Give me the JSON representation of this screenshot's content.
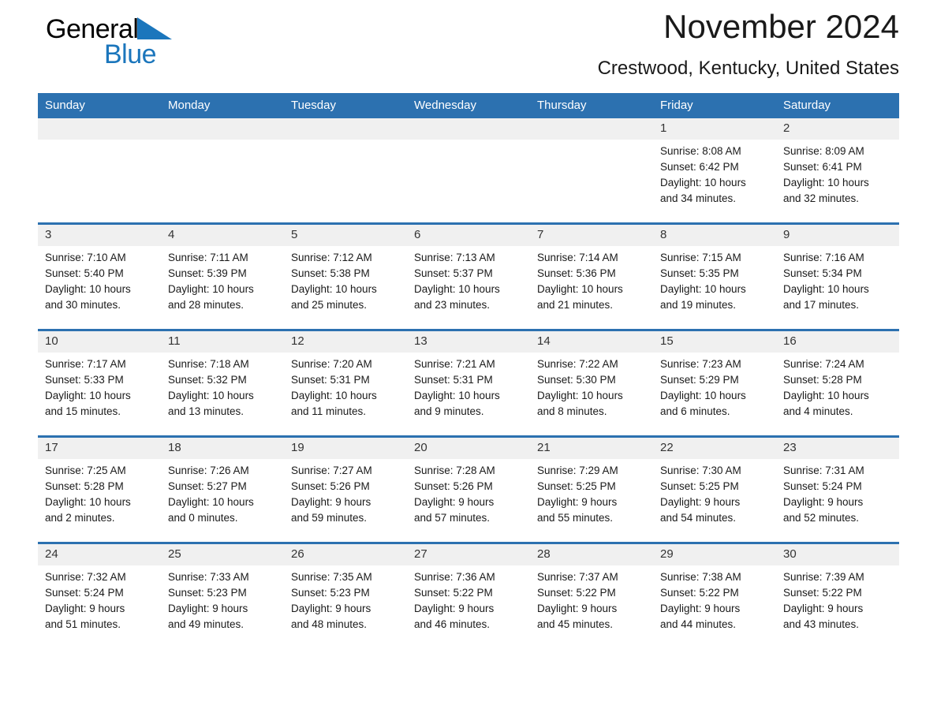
{
  "brand": {
    "name_part1": "General",
    "name_part2": "Blue",
    "logo_icon": "triangle-mark",
    "accent_color": "#1b76bc"
  },
  "header": {
    "title": "November 2024",
    "location": "Crestwood, Kentucky, United States"
  },
  "calendar": {
    "header_bg": "#2c71b0",
    "daynum_bg": "#f0f0f0",
    "weekday_headers": [
      "Sunday",
      "Monday",
      "Tuesday",
      "Wednesday",
      "Thursday",
      "Friday",
      "Saturday"
    ],
    "weeks": [
      [
        {
          "day": "",
          "lines": []
        },
        {
          "day": "",
          "lines": []
        },
        {
          "day": "",
          "lines": []
        },
        {
          "day": "",
          "lines": []
        },
        {
          "day": "",
          "lines": []
        },
        {
          "day": "1",
          "lines": [
            "Sunrise: 8:08 AM",
            "Sunset: 6:42 PM",
            "Daylight: 10 hours",
            "and 34 minutes."
          ]
        },
        {
          "day": "2",
          "lines": [
            "Sunrise: 8:09 AM",
            "Sunset: 6:41 PM",
            "Daylight: 10 hours",
            "and 32 minutes."
          ]
        }
      ],
      [
        {
          "day": "3",
          "lines": [
            "Sunrise: 7:10 AM",
            "Sunset: 5:40 PM",
            "Daylight: 10 hours",
            "and 30 minutes."
          ]
        },
        {
          "day": "4",
          "lines": [
            "Sunrise: 7:11 AM",
            "Sunset: 5:39 PM",
            "Daylight: 10 hours",
            "and 28 minutes."
          ]
        },
        {
          "day": "5",
          "lines": [
            "Sunrise: 7:12 AM",
            "Sunset: 5:38 PM",
            "Daylight: 10 hours",
            "and 25 minutes."
          ]
        },
        {
          "day": "6",
          "lines": [
            "Sunrise: 7:13 AM",
            "Sunset: 5:37 PM",
            "Daylight: 10 hours",
            "and 23 minutes."
          ]
        },
        {
          "day": "7",
          "lines": [
            "Sunrise: 7:14 AM",
            "Sunset: 5:36 PM",
            "Daylight: 10 hours",
            "and 21 minutes."
          ]
        },
        {
          "day": "8",
          "lines": [
            "Sunrise: 7:15 AM",
            "Sunset: 5:35 PM",
            "Daylight: 10 hours",
            "and 19 minutes."
          ]
        },
        {
          "day": "9",
          "lines": [
            "Sunrise: 7:16 AM",
            "Sunset: 5:34 PM",
            "Daylight: 10 hours",
            "and 17 minutes."
          ]
        }
      ],
      [
        {
          "day": "10",
          "lines": [
            "Sunrise: 7:17 AM",
            "Sunset: 5:33 PM",
            "Daylight: 10 hours",
            "and 15 minutes."
          ]
        },
        {
          "day": "11",
          "lines": [
            "Sunrise: 7:18 AM",
            "Sunset: 5:32 PM",
            "Daylight: 10 hours",
            "and 13 minutes."
          ]
        },
        {
          "day": "12",
          "lines": [
            "Sunrise: 7:20 AM",
            "Sunset: 5:31 PM",
            "Daylight: 10 hours",
            "and 11 minutes."
          ]
        },
        {
          "day": "13",
          "lines": [
            "Sunrise: 7:21 AM",
            "Sunset: 5:31 PM",
            "Daylight: 10 hours",
            "and 9 minutes."
          ]
        },
        {
          "day": "14",
          "lines": [
            "Sunrise: 7:22 AM",
            "Sunset: 5:30 PM",
            "Daylight: 10 hours",
            "and 8 minutes."
          ]
        },
        {
          "day": "15",
          "lines": [
            "Sunrise: 7:23 AM",
            "Sunset: 5:29 PM",
            "Daylight: 10 hours",
            "and 6 minutes."
          ]
        },
        {
          "day": "16",
          "lines": [
            "Sunrise: 7:24 AM",
            "Sunset: 5:28 PM",
            "Daylight: 10 hours",
            "and 4 minutes."
          ]
        }
      ],
      [
        {
          "day": "17",
          "lines": [
            "Sunrise: 7:25 AM",
            "Sunset: 5:28 PM",
            "Daylight: 10 hours",
            "and 2 minutes."
          ]
        },
        {
          "day": "18",
          "lines": [
            "Sunrise: 7:26 AM",
            "Sunset: 5:27 PM",
            "Daylight: 10 hours",
            "and 0 minutes."
          ]
        },
        {
          "day": "19",
          "lines": [
            "Sunrise: 7:27 AM",
            "Sunset: 5:26 PM",
            "Daylight: 9 hours",
            "and 59 minutes."
          ]
        },
        {
          "day": "20",
          "lines": [
            "Sunrise: 7:28 AM",
            "Sunset: 5:26 PM",
            "Daylight: 9 hours",
            "and 57 minutes."
          ]
        },
        {
          "day": "21",
          "lines": [
            "Sunrise: 7:29 AM",
            "Sunset: 5:25 PM",
            "Daylight: 9 hours",
            "and 55 minutes."
          ]
        },
        {
          "day": "22",
          "lines": [
            "Sunrise: 7:30 AM",
            "Sunset: 5:25 PM",
            "Daylight: 9 hours",
            "and 54 minutes."
          ]
        },
        {
          "day": "23",
          "lines": [
            "Sunrise: 7:31 AM",
            "Sunset: 5:24 PM",
            "Daylight: 9 hours",
            "and 52 minutes."
          ]
        }
      ],
      [
        {
          "day": "24",
          "lines": [
            "Sunrise: 7:32 AM",
            "Sunset: 5:24 PM",
            "Daylight: 9 hours",
            "and 51 minutes."
          ]
        },
        {
          "day": "25",
          "lines": [
            "Sunrise: 7:33 AM",
            "Sunset: 5:23 PM",
            "Daylight: 9 hours",
            "and 49 minutes."
          ]
        },
        {
          "day": "26",
          "lines": [
            "Sunrise: 7:35 AM",
            "Sunset: 5:23 PM",
            "Daylight: 9 hours",
            "and 48 minutes."
          ]
        },
        {
          "day": "27",
          "lines": [
            "Sunrise: 7:36 AM",
            "Sunset: 5:22 PM",
            "Daylight: 9 hours",
            "and 46 minutes."
          ]
        },
        {
          "day": "28",
          "lines": [
            "Sunrise: 7:37 AM",
            "Sunset: 5:22 PM",
            "Daylight: 9 hours",
            "and 45 minutes."
          ]
        },
        {
          "day": "29",
          "lines": [
            "Sunrise: 7:38 AM",
            "Sunset: 5:22 PM",
            "Daylight: 9 hours",
            "and 44 minutes."
          ]
        },
        {
          "day": "30",
          "lines": [
            "Sunrise: 7:39 AM",
            "Sunset: 5:22 PM",
            "Daylight: 9 hours",
            "and 43 minutes."
          ]
        }
      ]
    ]
  }
}
